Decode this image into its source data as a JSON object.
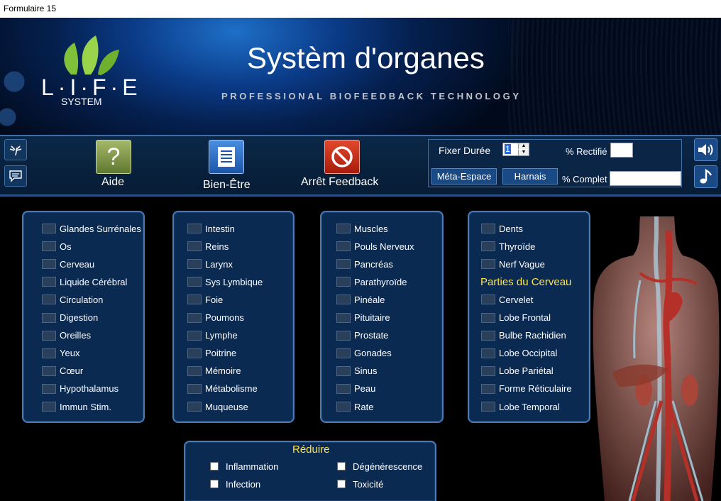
{
  "window": {
    "title": "Formulaire 15"
  },
  "header": {
    "logo_text": "L·I·F·E",
    "logo_sub": "SYSTEM",
    "title": "Systèm d'organes",
    "subtitle": "PROFESSIONAL BIOFEEDBACK TECHNOLOGY"
  },
  "toolbar": {
    "aide_label": "Aide",
    "bien_etre_label": "Bien-Être",
    "arret_label": "Arrêt Feedback",
    "duration_label": "Fixer Durée",
    "duration_value": "1",
    "rectifie_label": "% Rectifié",
    "complet_label": "% Complet",
    "meta_espace_label": "Méta-Espace",
    "harnais_label": "Harnais"
  },
  "columns": [
    {
      "items": [
        "Glandes Surrénales",
        "Os",
        "Cerveau",
        "Liquide Cérébral",
        "Circulation",
        "Digestion",
        "Oreilles",
        "Yeux",
        "Cœur",
        "Hypothalamus",
        "Immun Stim."
      ]
    },
    {
      "items": [
        "Intestin",
        "Reins",
        "Larynx",
        "Sys Lymbique",
        "Foie",
        "Poumons",
        "Lymphe",
        "Poitrine",
        "Mémoire",
        "Métabolisme",
        "Muqueuse"
      ]
    },
    {
      "items": [
        "Muscles",
        "Pouls Nerveux",
        "Pancréas",
        "Parathyroïde",
        "Pinéale",
        "Pituitaire",
        "Prostate",
        "Gonades",
        "Sinus",
        "Peau",
        "Rate"
      ]
    }
  ],
  "column4": {
    "items": [
      "Dents",
      "Thyroïde",
      "Nerf Vague"
    ],
    "heading": "Parties du Cerveau",
    "brain_items": [
      "Cervelet",
      "Lobe Frontal",
      "Bulbe Rachidien",
      "Lobe Occipital",
      "Lobe Pariétal",
      "Forme Réticulaire",
      "Lobe Temporal"
    ]
  },
  "reduire": {
    "title": "Réduire",
    "items": [
      "Inflammation",
      "Dégénérescence",
      "Infection",
      "Toxicité"
    ]
  },
  "colors": {
    "accent": "#ffe54a",
    "panel": "#0b2a52",
    "border": "#4b79b5"
  }
}
